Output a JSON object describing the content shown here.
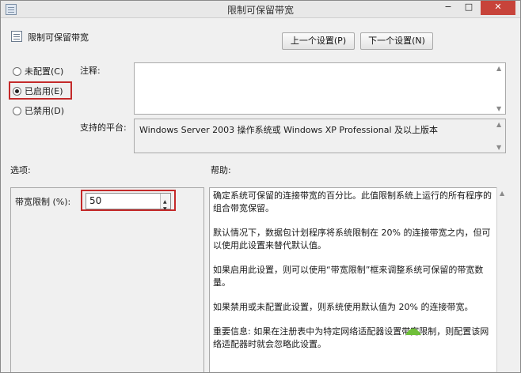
{
  "window": {
    "title": "限制可保留带宽",
    "minimize_glyph": "−",
    "maximize_glyph": "□",
    "close_glyph": "✕"
  },
  "header": {
    "setting_name": "限制可保留带宽",
    "prev_button": "上一个设置(P)",
    "next_button": "下一个设置(N)"
  },
  "state": {
    "not_configured": "未配置(C)",
    "enabled": "已启用(E)",
    "disabled": "已禁用(D)",
    "selected": "enabled"
  },
  "labels": {
    "comment": "注释:",
    "supported_on": "支持的平台:",
    "options": "选项:",
    "help": "帮助:"
  },
  "comment_value": "",
  "supported_platform": "Windows Server 2003 操作系统或 Windows XP Professional 及以上版本",
  "options": {
    "bandwidth_label": "带宽限制 (%):",
    "bandwidth_value": "50"
  },
  "help_text": [
    "确定系统可保留的连接带宽的百分比。此值限制系统上运行的所有程序的组合带宽保留。",
    "默认情况下，数据包计划程序将系统限制在 20% 的连接带宽之内，但可以使用此设置来替代默认值。",
    "如果启用此设置，则可以使用“带宽限制”框来调整系统可保留的带宽数量。",
    "如果禁用或未配置此设置，则系统使用默认值为 20% 的连接带宽。",
    "重要信息: 如果在注册表中为特定网络适配器设置带宽限制，则配置该网络适配器时就会忽略此设置。"
  ],
  "icons": {
    "title": "policy-icon",
    "setting": "policy-icon",
    "spin_up": "▲",
    "spin_down": "▼",
    "scroll_up": "▲",
    "scroll_down": "▼"
  },
  "colors": {
    "highlight": "#c42a2a",
    "close_button": "#c7433a",
    "watermark": "#6fbf3a"
  }
}
